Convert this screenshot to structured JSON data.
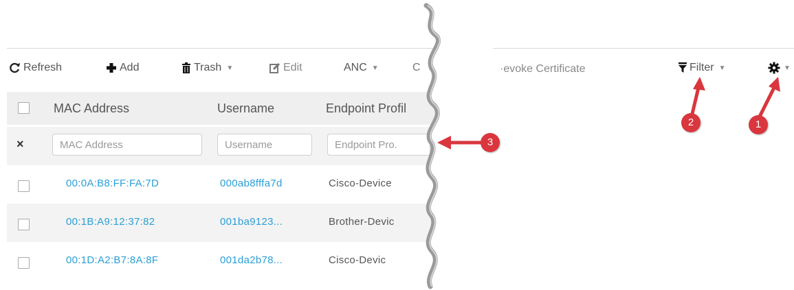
{
  "toolbar": {
    "refresh": "Refresh",
    "add": "Add",
    "trash": "Trash",
    "edit": "Edit",
    "anc": "ANC",
    "partial": "C",
    "revoke": "·evoke Certificate",
    "filter": "Filter"
  },
  "table": {
    "headers": [
      "MAC Address",
      "Username",
      "Endpoint Profil"
    ],
    "filters": {
      "clear": "×",
      "mac_placeholder": "MAC Address",
      "user_placeholder": "Username",
      "profile_placeholder": "Endpoint Pro."
    },
    "rows": [
      {
        "mac": "00:0A:B8:FF:FA:7D",
        "username": "000ab8fffa7d",
        "profile": "Cisco-Device"
      },
      {
        "mac": "00:1B:A9:12:37:82",
        "username": "001ba9123...",
        "profile": "Brother-Devic"
      },
      {
        "mac": "00:1D:A2:B7:8A:8F",
        "username": "001da2b78...",
        "profile": "Cisco-Devic"
      }
    ]
  },
  "callouts": [
    {
      "label": "1",
      "target": "settings"
    },
    {
      "label": "2",
      "target": "filter"
    },
    {
      "label": "3",
      "target": "endpoint-profile-filter"
    }
  ],
  "colors": {
    "link": "#2a9fd6",
    "callout": "#d9363e",
    "header_bg": "#efefef"
  }
}
